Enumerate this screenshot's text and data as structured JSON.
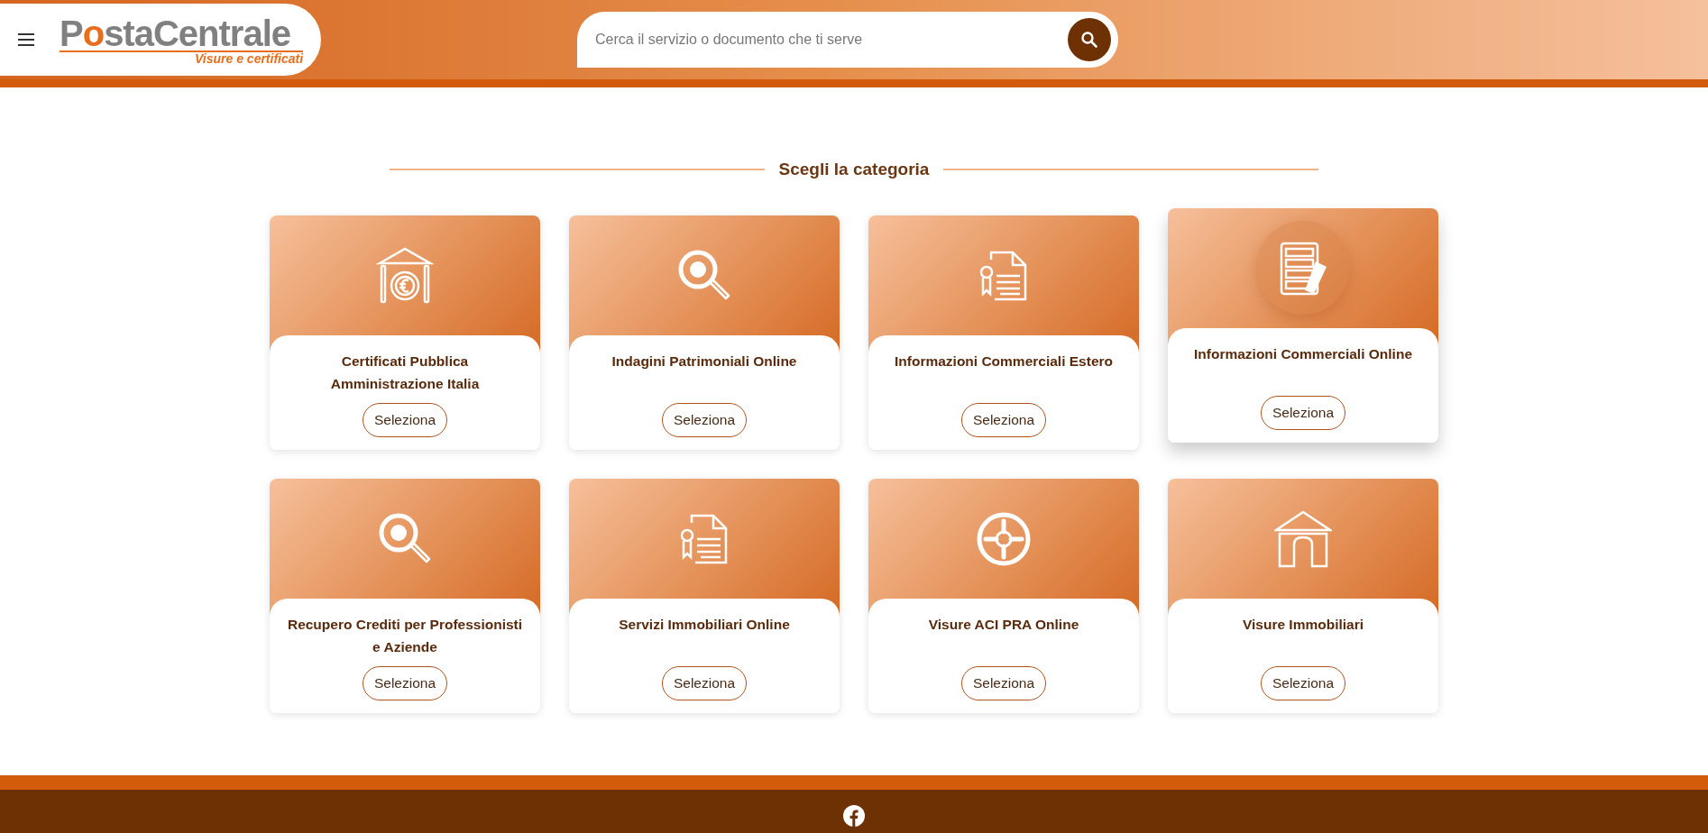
{
  "header": {
    "logo": {
      "text": "PostaCentrale",
      "tagline": "Visure e certificati"
    },
    "search": {
      "placeholder": "Cerca il servizio o documento che ti serve"
    }
  },
  "section_title": "Scegli la categoria",
  "categories": [
    {
      "title": "Certificati Pubblica Amministrazione Italia",
      "button": "Seleziona",
      "kind": "bank",
      "hovered": false
    },
    {
      "title": "Indagini Patrimoniali Online",
      "button": "Seleziona",
      "kind": "magnifier",
      "hovered": false
    },
    {
      "title": "Informazioni Commerciali Estero",
      "button": "Seleziona",
      "kind": "certificate",
      "hovered": false
    },
    {
      "title": "Informazioni Commerciali Online",
      "button": "Seleziona",
      "kind": "server",
      "hovered": true
    },
    {
      "title": "Recupero Crediti per Professionisti e Aziende",
      "button": "Seleziona",
      "kind": "magnifier",
      "hovered": false
    },
    {
      "title": "Servizi Immobiliari Online",
      "button": "Seleziona",
      "kind": "certificate",
      "hovered": false
    },
    {
      "title": "Visure ACI PRA Online",
      "button": "Seleziona",
      "kind": "wheel",
      "hovered": false
    },
    {
      "title": "Visure Immobiliari",
      "button": "Seleziona",
      "kind": "house",
      "hovered": false
    }
  ]
}
